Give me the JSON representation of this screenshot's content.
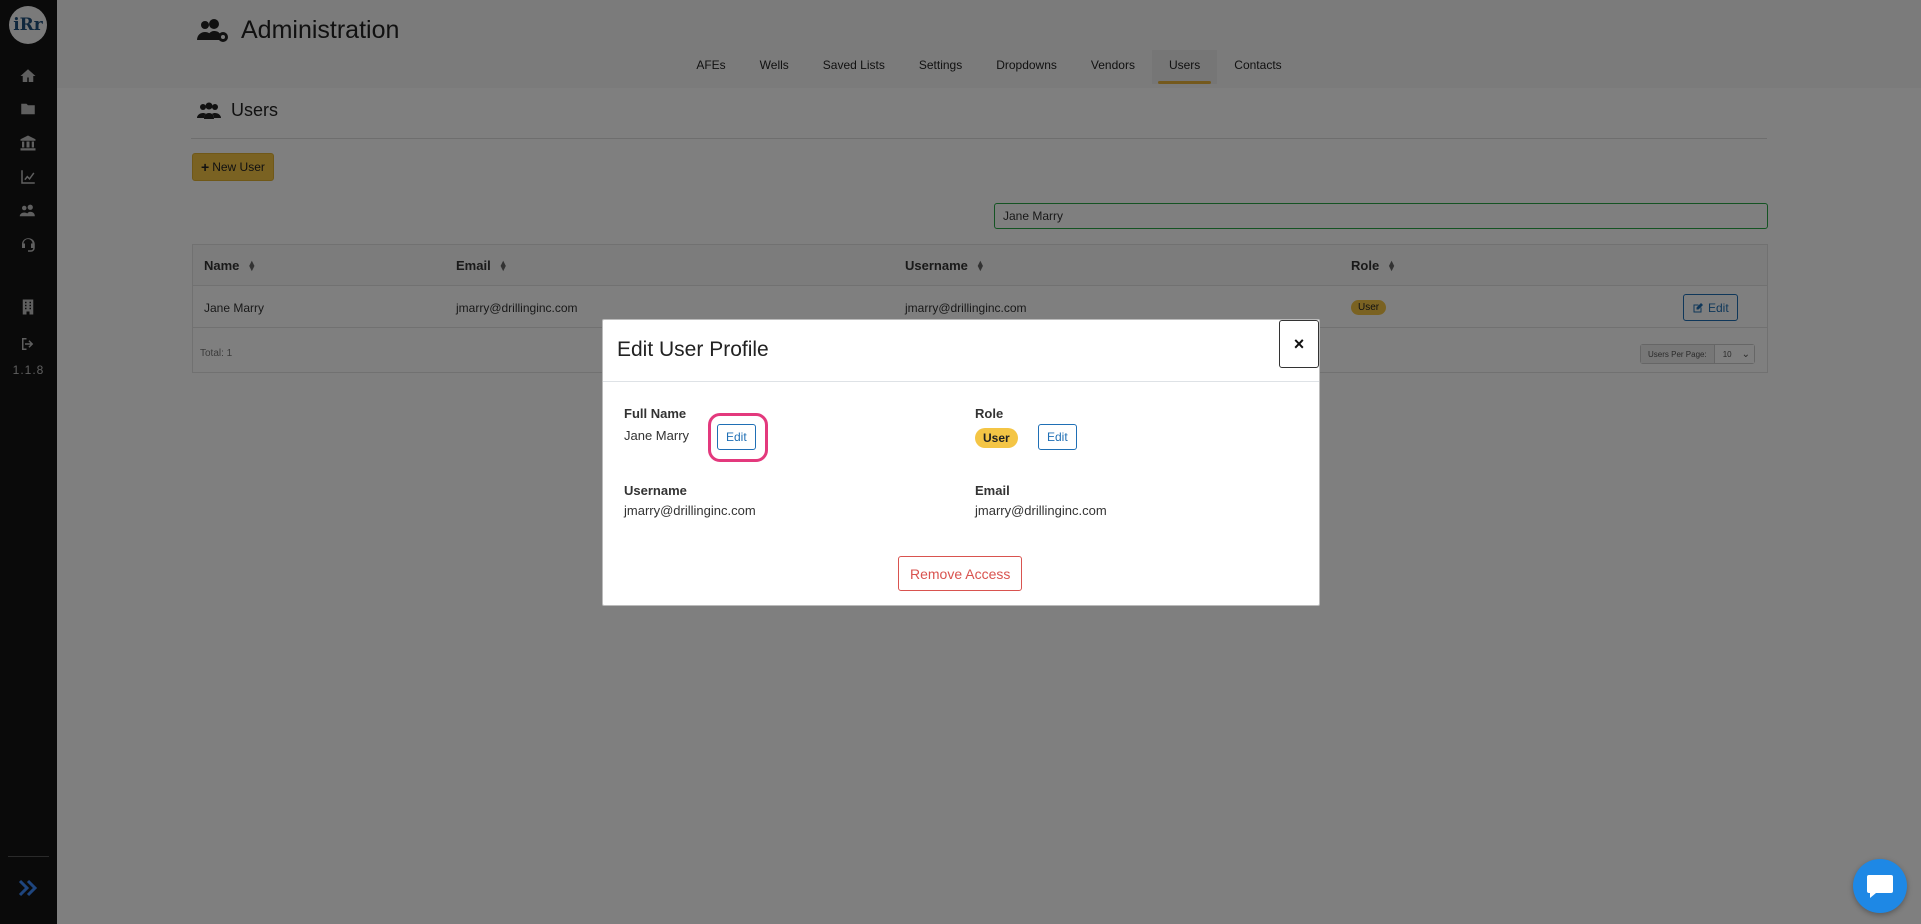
{
  "app": {
    "version": "1.1.8",
    "logo_text": "iRr"
  },
  "header": {
    "title": "Administration",
    "tabs": [
      {
        "label": "AFEs",
        "active": false
      },
      {
        "label": "Wells",
        "active": false
      },
      {
        "label": "Saved Lists",
        "active": false
      },
      {
        "label": "Settings",
        "active": false
      },
      {
        "label": "Dropdowns",
        "active": false
      },
      {
        "label": "Vendors",
        "active": false
      },
      {
        "label": "Users",
        "active": true
      },
      {
        "label": "Contacts",
        "active": false
      }
    ]
  },
  "users_page": {
    "section_title": "Users",
    "new_user_label": "New User",
    "search_value": "Jane Marry",
    "columns": [
      "Name",
      "Email",
      "Username",
      "Role"
    ],
    "rows": [
      {
        "name": "Jane Marry",
        "email": "jmarry@drillinginc.com",
        "username": "jmarry@drillinginc.com",
        "role": "User",
        "edit_label": "Edit"
      }
    ],
    "total_label": "Total: 1",
    "per_page_label": "Users Per Page:",
    "per_page_value": "10"
  },
  "modal": {
    "title": "Edit User Profile",
    "close_label": "×",
    "full_name_label": "Full Name",
    "full_name_value": "Jane Marry",
    "role_label": "Role",
    "role_value": "User",
    "username_label": "Username",
    "username_value": "jmarry@drillinginc.com",
    "email_label": "Email",
    "email_value": "jmarry@drillinginc.com",
    "edit_label": "Edit",
    "remove_label": "Remove Access"
  },
  "colors": {
    "accent": "#f4c545",
    "link": "#1f6fb5",
    "danger": "#d9534f",
    "highlight": "#e3397d",
    "sidebar": "#141414"
  },
  "icons": {
    "sidebar": [
      "home-icon",
      "folder-icon",
      "bank-icon",
      "chart-line-icon",
      "users-cog-icon",
      "headset-icon",
      "building-icon",
      "sign-out-icon"
    ],
    "expand": "double-chevron-right-icon",
    "chat": "chat-bubble-icon"
  }
}
